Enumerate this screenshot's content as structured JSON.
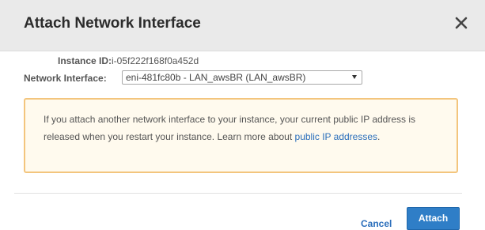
{
  "dialog": {
    "title": "Attach Network Interface",
    "close_icon": "close-icon"
  },
  "instance": {
    "label": "Instance ID:",
    "value": "i-05f222f168f0a452d"
  },
  "network_interface": {
    "label": "Network Interface:",
    "selected": "eni-481fc80b - LAN_awsBR (LAN_awsBR)"
  },
  "warning": {
    "text": "If you attach another network interface to your instance, your current public IP address is released when you restart your instance. Learn more about ",
    "link_label": "public IP addresses",
    "suffix": ".",
    "border_color": "#f3c57d",
    "background_color": "#fffaee"
  },
  "footer": {
    "cancel_label": "Cancel",
    "attach_label": "Attach",
    "accent_color": "#2f7ec7"
  }
}
